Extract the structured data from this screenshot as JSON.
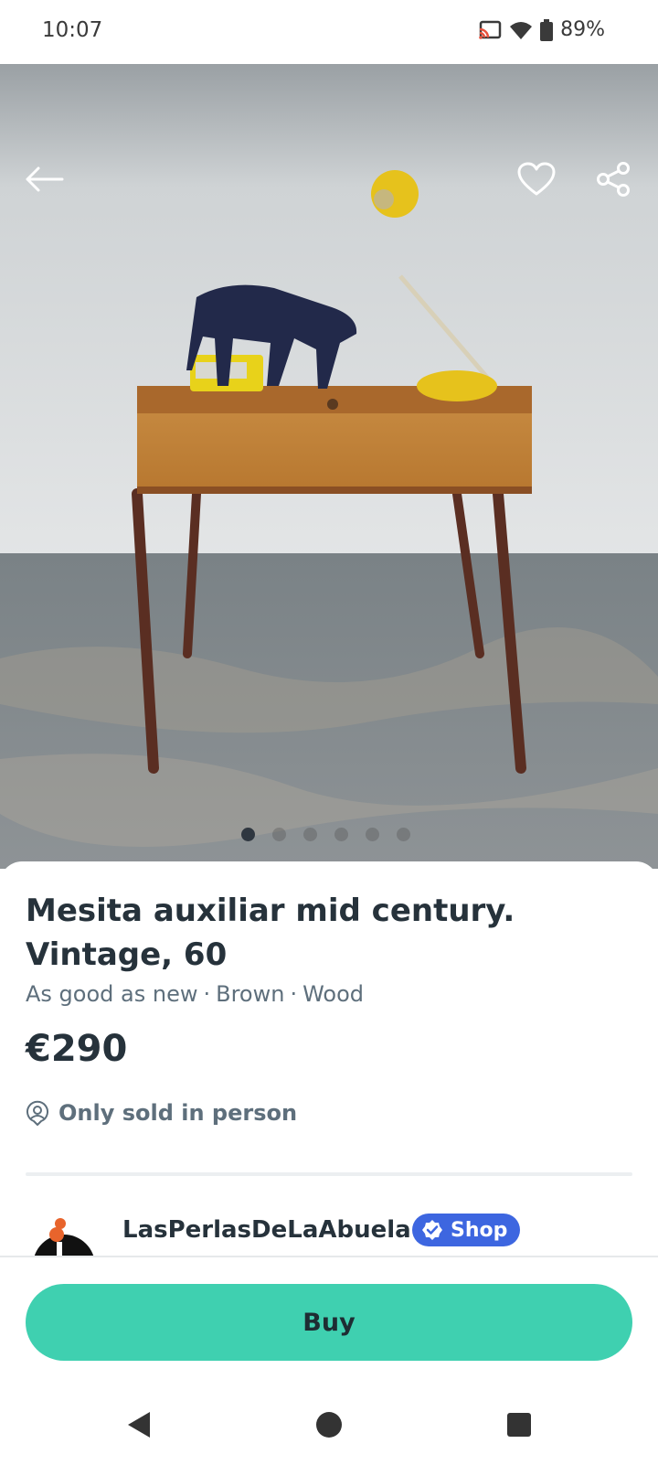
{
  "status_bar": {
    "time": "10:07",
    "battery": "89%",
    "icons": [
      "cast-icon",
      "wifi-icon",
      "battery-icon"
    ]
  },
  "gallery": {
    "photo_count": 6,
    "active_index": 0,
    "actions": [
      "back-arrow-icon",
      "heart-icon",
      "share-icon"
    ]
  },
  "product": {
    "title": "Mesita auxiliar mid century. Vintage, 60",
    "condition": "As good as new",
    "color": "Brown",
    "material": "Wood",
    "separator": "·",
    "price": "€290",
    "delivery": "Only sold in person"
  },
  "seller": {
    "name": "LasPerlasDeLaAbuela ..",
    "badge": "Shop"
  },
  "actions": {
    "buy_label": "Buy"
  },
  "colors": {
    "buy_button": "#3fd0b0",
    "shop_badge": "#3d66e0",
    "text_primary": "#26323b",
    "text_secondary": "#5e6f7c"
  },
  "nav_bar": [
    "back-triangle-icon",
    "home-circle-icon",
    "recents-square-icon"
  ]
}
